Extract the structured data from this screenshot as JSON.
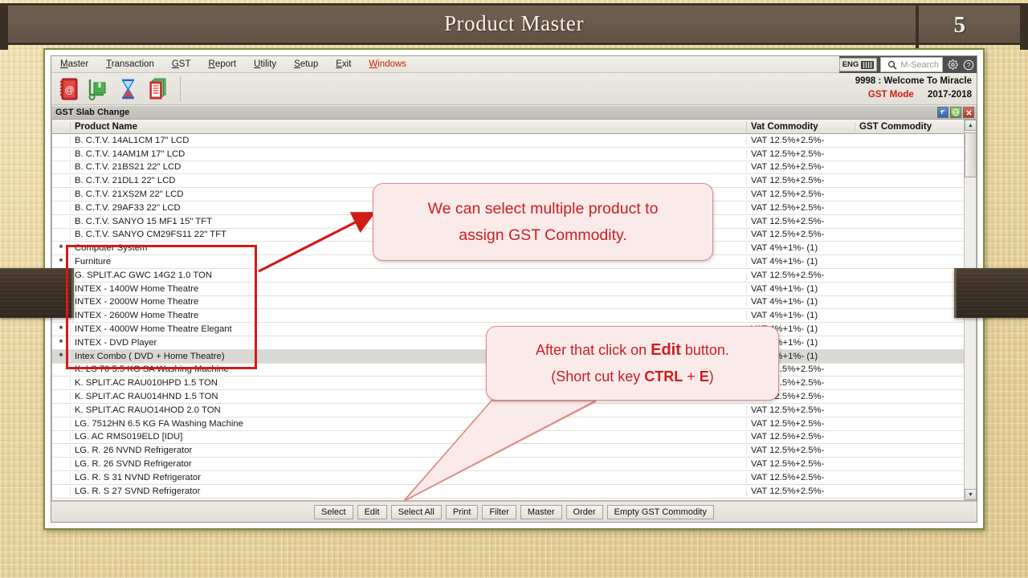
{
  "slide": {
    "banner_title": "Product Master",
    "page_number": "5"
  },
  "app": {
    "menubar": {
      "items": [
        {
          "label": "Master",
          "accel": "M",
          "accent": false
        },
        {
          "label": "Transaction",
          "accel": "T",
          "accent": false
        },
        {
          "label": "GST",
          "accel": "G",
          "accent": false
        },
        {
          "label": "Report",
          "accel": "R",
          "accent": false
        },
        {
          "label": "Utility",
          "accel": "U",
          "accent": false
        },
        {
          "label": "Setup",
          "accel": "S",
          "accent": false
        },
        {
          "label": "Exit",
          "accel": "E",
          "accent": false
        },
        {
          "label": "Windows",
          "accel": "W",
          "accent": true
        }
      ],
      "lang_badge": "ENG",
      "search_placeholder": "M-Search",
      "icons": [
        "keyboard-icon",
        "search-icon",
        "gear-icon",
        "help-icon"
      ]
    },
    "toolbar": {
      "icons": [
        "address-book-icon",
        "hand-truck-icon",
        "hourglass-icon",
        "document-stack-icon"
      ]
    },
    "company": {
      "welcome": "9998 : Welcome To Miracle",
      "mode": "GST Mode",
      "financial_year": "2017-2018",
      "mode_color": "#d11b11"
    },
    "window": {
      "title": "GST Slab Change",
      "controls": [
        {
          "name": "restore",
          "glyph": "⤴",
          "color": "#2f62ad"
        },
        {
          "name": "globe",
          "glyph": "●",
          "color": "#4f9a3a"
        },
        {
          "name": "close",
          "glyph": "✕",
          "color": "#c22d18"
        }
      ]
    },
    "grid": {
      "columns": [
        "",
        "Product Name",
        "Vat Commodity",
        "GST Commodity"
      ],
      "rows": [
        {
          "mark": "",
          "name": "B. C.T.V. 14AL1CM 17\" LCD",
          "vat": "VAT 12.5%+2.5%-",
          "gst": "",
          "selected": false
        },
        {
          "mark": "",
          "name": "B. C.T.V. 14AM1M 17\" LCD",
          "vat": "VAT 12.5%+2.5%-",
          "gst": "",
          "selected": false
        },
        {
          "mark": "",
          "name": "B. C.T.V. 21BS21 22\" LCD",
          "vat": "VAT 12.5%+2.5%-",
          "gst": "",
          "selected": false
        },
        {
          "mark": "",
          "name": "B. C.T.V. 21DL1 22\" LCD",
          "vat": "VAT 12.5%+2.5%-",
          "gst": "",
          "selected": false
        },
        {
          "mark": "",
          "name": "B. C.T.V. 21XS2M 22\" LCD",
          "vat": "VAT 12.5%+2.5%-",
          "gst": "",
          "selected": false
        },
        {
          "mark": "",
          "name": "B. C.T.V. 29AF33 22\" LCD",
          "vat": "VAT 12.5%+2.5%-",
          "gst": "",
          "selected": false
        },
        {
          "mark": "",
          "name": "B. C.T.V. SANYO 15 MF1 15\" TFT",
          "vat": "VAT 12.5%+2.5%-",
          "gst": "",
          "selected": false
        },
        {
          "mark": "",
          "name": "B. C.T.V. SANYO CM29FS11 22\" TFT",
          "vat": "VAT 12.5%+2.5%-",
          "gst": "",
          "selected": false
        },
        {
          "mark": "*",
          "name": "Computer System",
          "vat": "VAT 4%+1%- (1)",
          "gst": "",
          "selected": false
        },
        {
          "mark": "*",
          "name": "Furniture",
          "vat": "VAT 4%+1%- (1)",
          "gst": "",
          "selected": false
        },
        {
          "mark": "",
          "name": "G. SPLIT.AC GWC 14G2 1.0 TON",
          "vat": "VAT 12.5%+2.5%-",
          "gst": "",
          "selected": false
        },
        {
          "mark": "*",
          "name": "INTEX - 1400W Home Theatre",
          "vat": "VAT 4%+1%- (1)",
          "gst": "",
          "selected": false
        },
        {
          "mark": "*",
          "name": "INTEX - 2000W Home Theatre",
          "vat": "VAT 4%+1%- (1)",
          "gst": "",
          "selected": false
        },
        {
          "mark": "*",
          "name": "INTEX - 2600W Home Theatre",
          "vat": "VAT 4%+1%- (1)",
          "gst": "",
          "selected": false
        },
        {
          "mark": "*",
          "name": "INTEX - 4000W Home Theatre Elegant",
          "vat": "VAT 4%+1%- (1)",
          "gst": "",
          "selected": false
        },
        {
          "mark": "*",
          "name": "INTEX - DVD Player",
          "vat": "VAT 4%+1%- (1)",
          "gst": "",
          "selected": false
        },
        {
          "mark": "*",
          "name": "Intex Combo ( DVD + Home Theatre)",
          "vat": "VAT 4%+1%- (1)",
          "gst": "",
          "selected": true
        },
        {
          "mark": "",
          "name": "K. LS 70 5.5 KG SA Washing Machine",
          "vat": "VAT 12.5%+2.5%-",
          "gst": "",
          "selected": false
        },
        {
          "mark": "",
          "name": "K. SPLIT.AC RAU010HPD 1.5 TON",
          "vat": "VAT 12.5%+2.5%-",
          "gst": "",
          "selected": false
        },
        {
          "mark": "",
          "name": "K. SPLIT.AC RAU014HND 1.5 TON",
          "vat": "VAT 12.5%+2.5%-",
          "gst": "",
          "selected": false
        },
        {
          "mark": "",
          "name": "K. SPLIT.AC RAUO14HOD 2.0 TON",
          "vat": "VAT 12.5%+2.5%-",
          "gst": "",
          "selected": false
        },
        {
          "mark": "",
          "name": "LG. 7512HN 6.5 KG FA Washing Machine",
          "vat": "VAT 12.5%+2.5%-",
          "gst": "",
          "selected": false
        },
        {
          "mark": "",
          "name": "LG. AC RMS019ELD [IDU]",
          "vat": "VAT 12.5%+2.5%-",
          "gst": "",
          "selected": false
        },
        {
          "mark": "",
          "name": "LG. R. 26 NVND Refrigerator",
          "vat": "VAT 12.5%+2.5%-",
          "gst": "",
          "selected": false
        },
        {
          "mark": "",
          "name": "LG. R. 26 SVND Refrigerator",
          "vat": "VAT 12.5%+2.5%-",
          "gst": "",
          "selected": false
        },
        {
          "mark": "",
          "name": "LG. R. S 31 NVND Refrigerator",
          "vat": "VAT 12.5%+2.5%-",
          "gst": "",
          "selected": false
        },
        {
          "mark": "",
          "name": "LG. R. S 27 SVND Refrigerator",
          "vat": "VAT 12.5%+2.5%-",
          "gst": "",
          "selected": false
        }
      ]
    },
    "buttons": [
      "Select",
      "Edit",
      "Select All",
      "Print",
      "Filter",
      "Master",
      "Order",
      "Empty GST Commodity"
    ]
  },
  "annotations": {
    "callout1": {
      "line1": "We can select multiple product to",
      "line2": "assign GST Commodity."
    },
    "callout2": {
      "line1_a": "After  that  click  on ",
      "line1_b": "Edit",
      "line1_c": " button.",
      "line2_a": "(Short cut key ",
      "line2_b": "CTRL",
      "line2_c": " + ",
      "line2_d": "E",
      "line2_e": ")"
    },
    "accent_color": "#cc1f1f"
  }
}
